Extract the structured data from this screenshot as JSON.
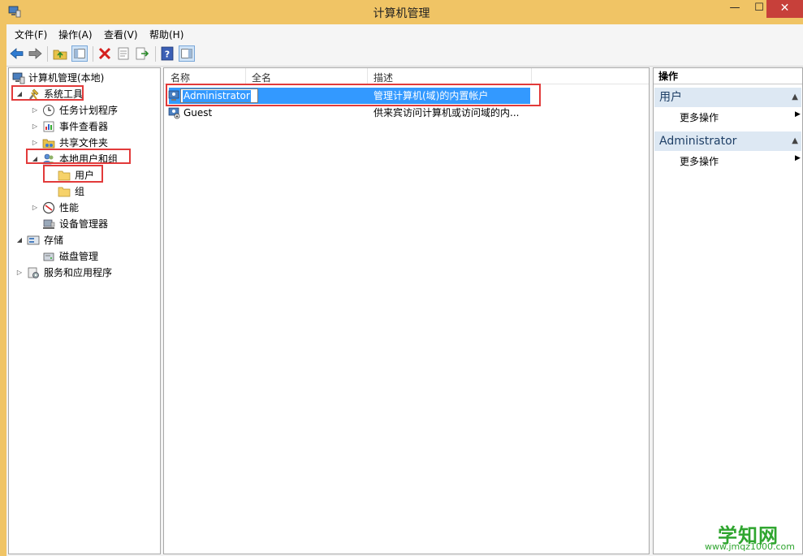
{
  "window": {
    "title": "计算机管理",
    "min_glyph": "—",
    "max_glyph": "☐",
    "close_glyph": "✕"
  },
  "menu": [
    "文件(F)",
    "操作(A)",
    "查看(V)",
    "帮助(H)"
  ],
  "toolbar": [
    "back-icon",
    "forward-icon",
    "up-folder-icon",
    "show-hide-tree-icon",
    "delete-icon",
    "properties-icon",
    "export-list-icon",
    "help-icon",
    "show-hide-action-pane-icon"
  ],
  "tree": [
    {
      "label": "计算机管理(本地)",
      "icon": "computer-management-icon",
      "expanded": true
    },
    {
      "label": "系统工具",
      "icon": "tools-icon",
      "expanded": true
    },
    {
      "label": "任务计划程序",
      "icon": "clock-icon",
      "expanded": false
    },
    {
      "label": "事件查看器",
      "icon": "event-viewer-icon",
      "expanded": false
    },
    {
      "label": "共享文件夹",
      "icon": "shared-folder-icon",
      "expanded": false
    },
    {
      "label": "本地用户和组",
      "icon": "users-group-icon",
      "expanded": true
    },
    {
      "label": "用户",
      "icon": "folder-icon",
      "selected": true
    },
    {
      "label": "组",
      "icon": "folder-icon"
    },
    {
      "label": "性能",
      "icon": "performance-icon",
      "expanded": false
    },
    {
      "label": "设备管理器",
      "icon": "device-manager-icon"
    },
    {
      "label": "存储",
      "icon": "storage-icon",
      "expanded": true
    },
    {
      "label": "磁盘管理",
      "icon": "disk-icon"
    },
    {
      "label": "服务和应用程序",
      "icon": "services-icon",
      "expanded": false
    }
  ],
  "list": {
    "columns": [
      "名称",
      "全名",
      "描述"
    ],
    "rows": [
      {
        "name": "Administrator",
        "full_name": "",
        "description": "管理计算机(域)的内置帐户",
        "selected": true
      },
      {
        "name": "Guest",
        "full_name": "",
        "description": "供来宾访问计算机或访问域的内..."
      }
    ]
  },
  "actions": {
    "title": "操作",
    "sections": [
      {
        "title": "用户",
        "items": [
          "更多操作"
        ]
      },
      {
        "title": "Administrator",
        "items": [
          "更多操作"
        ]
      }
    ]
  },
  "watermark": {
    "main": "学知网",
    "sub": "www.jmqz1000.com"
  },
  "colors": {
    "title_bar": "#f0c465",
    "selection": "#3399ff",
    "highlight": "#e23a3a",
    "close_button": "#c7403a",
    "watermark": "#2fa52f"
  }
}
